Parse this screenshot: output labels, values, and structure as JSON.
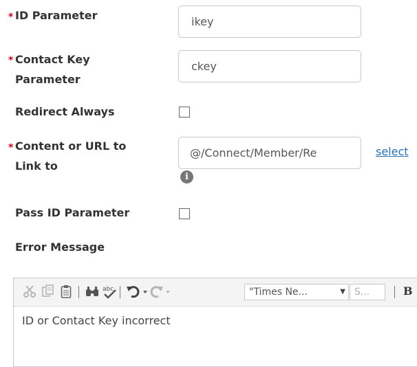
{
  "form": {
    "id_parameter": {
      "label": "ID Parameter",
      "value": "ikey",
      "required_mark": "*"
    },
    "contact_key_parameter": {
      "label_line1": "Contact Key",
      "label_line2": "Parameter",
      "value": "ckey",
      "required_mark": "*"
    },
    "redirect_always": {
      "label": "Redirect Always",
      "checked": false
    },
    "content_or_url": {
      "label_line1": "Content or URL to",
      "label_line2": "Link to",
      "value": "@/Connect/Member/Re",
      "select_link": "select",
      "info_icon": "info-icon",
      "required_mark": "*"
    },
    "pass_id_parameter": {
      "label": "Pass ID Parameter",
      "checked": false
    },
    "error_message": {
      "label": "Error Message",
      "toolbar": {
        "font_name": "\"Times Ne...",
        "font_size": "S...",
        "bold": "B",
        "icons": [
          "cut-icon",
          "copy-icon",
          "paste-icon",
          "find-icon",
          "spellcheck-icon",
          "undo-icon",
          "redo-icon"
        ]
      },
      "content": "ID or Contact Key incorrect"
    }
  },
  "colors": {
    "required": "#d0021b",
    "link": "#2b6fb3",
    "border": "#c9c9c9"
  }
}
